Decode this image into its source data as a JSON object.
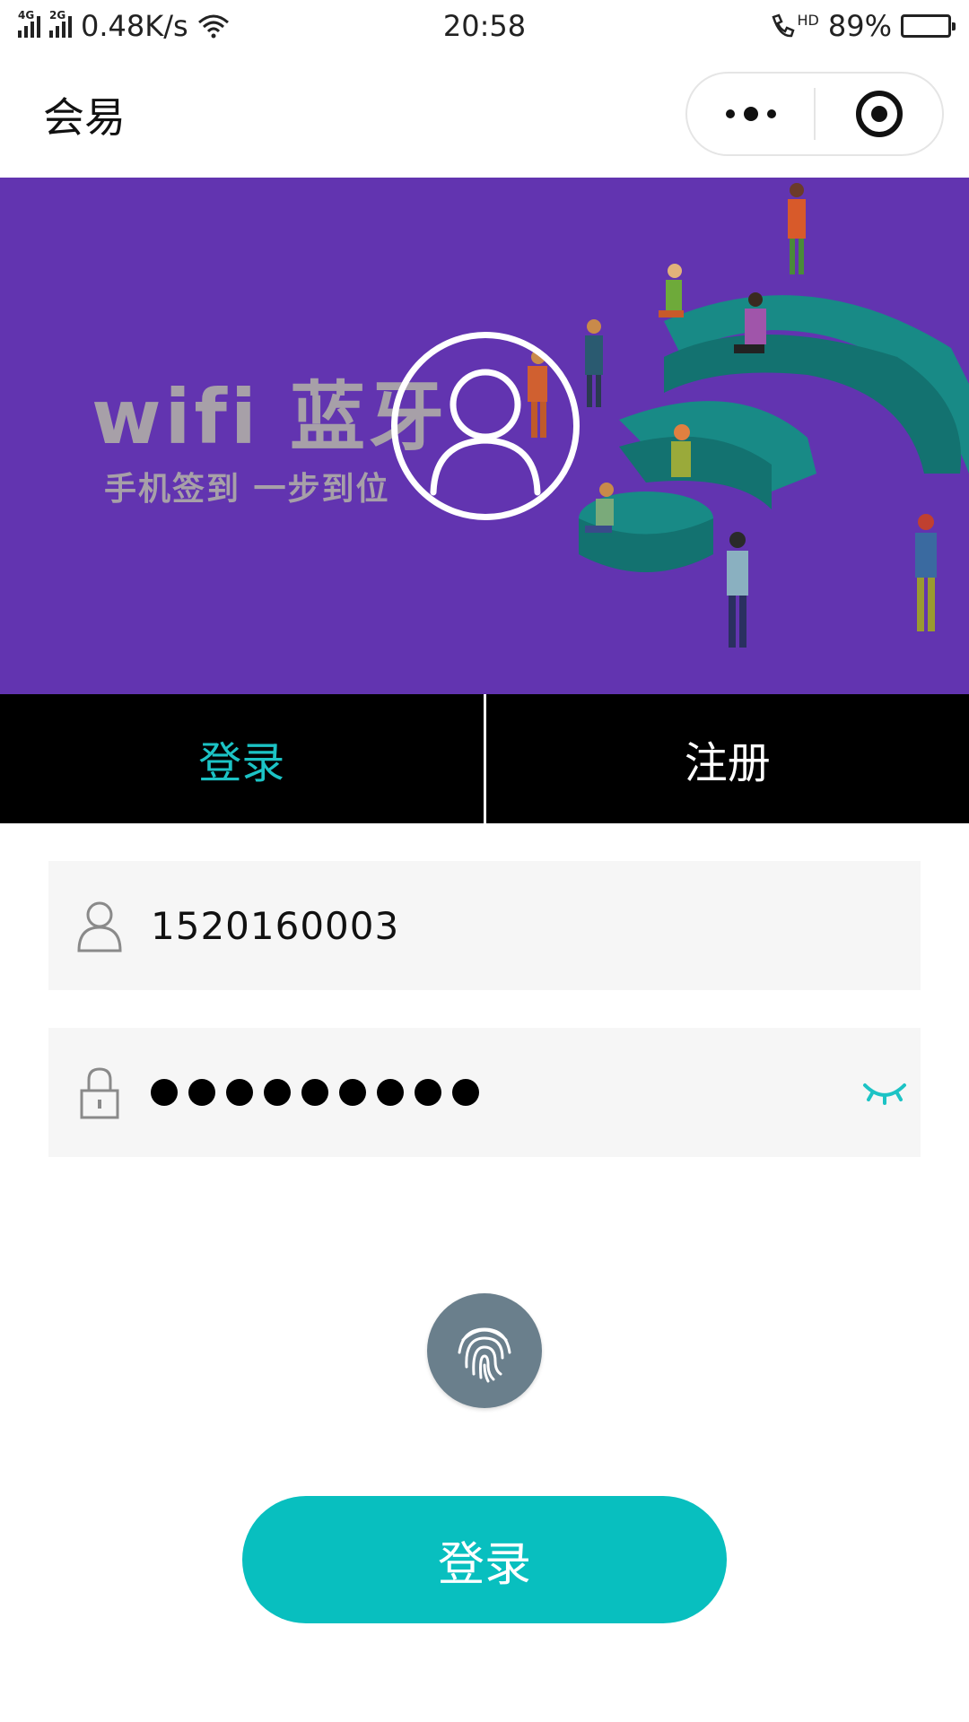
{
  "status_bar": {
    "network_1": "4G",
    "network_2": "2G",
    "speed": "0.48K/s",
    "time": "20:58",
    "call_badge": "HD",
    "battery_percent": "89%",
    "battery_level": 0.89,
    "icons": [
      "signal-icon",
      "wifi-icon",
      "hd-call-icon",
      "battery-icon"
    ]
  },
  "nav": {
    "title": "会易",
    "icons": [
      "more-dots-icon",
      "close-target-icon"
    ]
  },
  "banner": {
    "headline": "wifi  蓝牙",
    "subline": "手机签到  一步到位",
    "background": "#6234b0",
    "icon": "user-avatar-icon"
  },
  "tabs": {
    "login_label": "登录",
    "register_label": "注册",
    "active": "login",
    "active_color": "#1cc3c5"
  },
  "form": {
    "username_value": "1520160003",
    "password_masked_length": 9,
    "icons": [
      "user-icon",
      "lock-icon",
      "eye-closed-icon",
      "fingerprint-icon"
    ]
  },
  "login_button": {
    "label": "登录",
    "color": "#08bfbf"
  }
}
